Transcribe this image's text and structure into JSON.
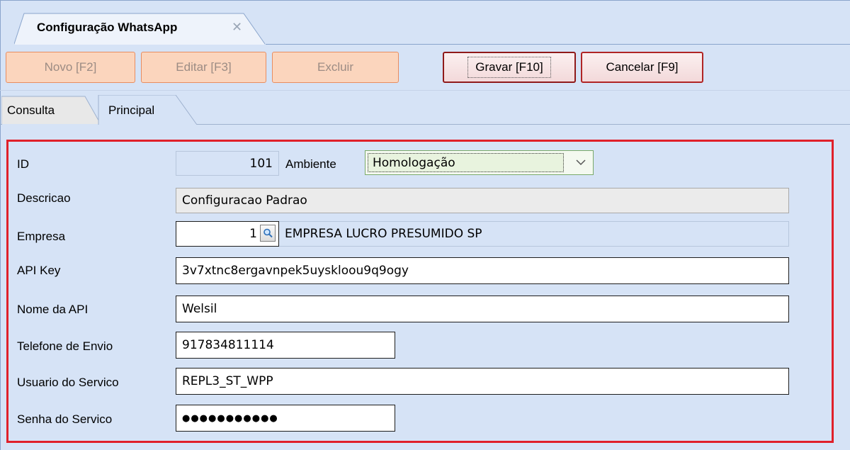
{
  "window": {
    "doc_tab_title": "Configuração WhatsApp",
    "close_glyph": "✕"
  },
  "toolbar": {
    "novo_label": "Novo [F2]",
    "editar_label": "Editar [F3]",
    "excluir_label": "Excluir",
    "gravar_label": "Gravar [F10]",
    "cancelar_label": "Cancelar [F9]"
  },
  "tabs": {
    "consulta": "Consulta",
    "principal": "Principal"
  },
  "form": {
    "id": {
      "label": "ID",
      "value": "101"
    },
    "ambiente": {
      "label": "Ambiente",
      "value": "Homologação"
    },
    "descricao": {
      "label": "Descricao",
      "value": "Configuracao Padrao"
    },
    "empresa": {
      "label": "Empresa",
      "code": "1",
      "name": "EMPRESA LUCRO PRESUMIDO SP"
    },
    "api_key": {
      "label": "API Key",
      "value": "3v7xtnc8ergavnpek5uyskloou9q9ogy"
    },
    "nome_api": {
      "label": "Nome da API",
      "value": "Welsil"
    },
    "telefone": {
      "label": "Telefone de Envio",
      "value": "917834811114"
    },
    "usuario": {
      "label": "Usuario do Servico",
      "value": "REPL3_ST_WPP"
    },
    "senha": {
      "label": "Senha do Servico",
      "value": "●●●●●●●●●●●"
    }
  },
  "icons": {
    "close": "close-icon",
    "lookup": "search-icon",
    "dropdown": "chevron-down-icon"
  },
  "colors": {
    "background": "#d6e3f6",
    "highlight_border": "#e0202a",
    "disabled_button": "#fbd5bd",
    "active_button_border": "#b02525"
  }
}
